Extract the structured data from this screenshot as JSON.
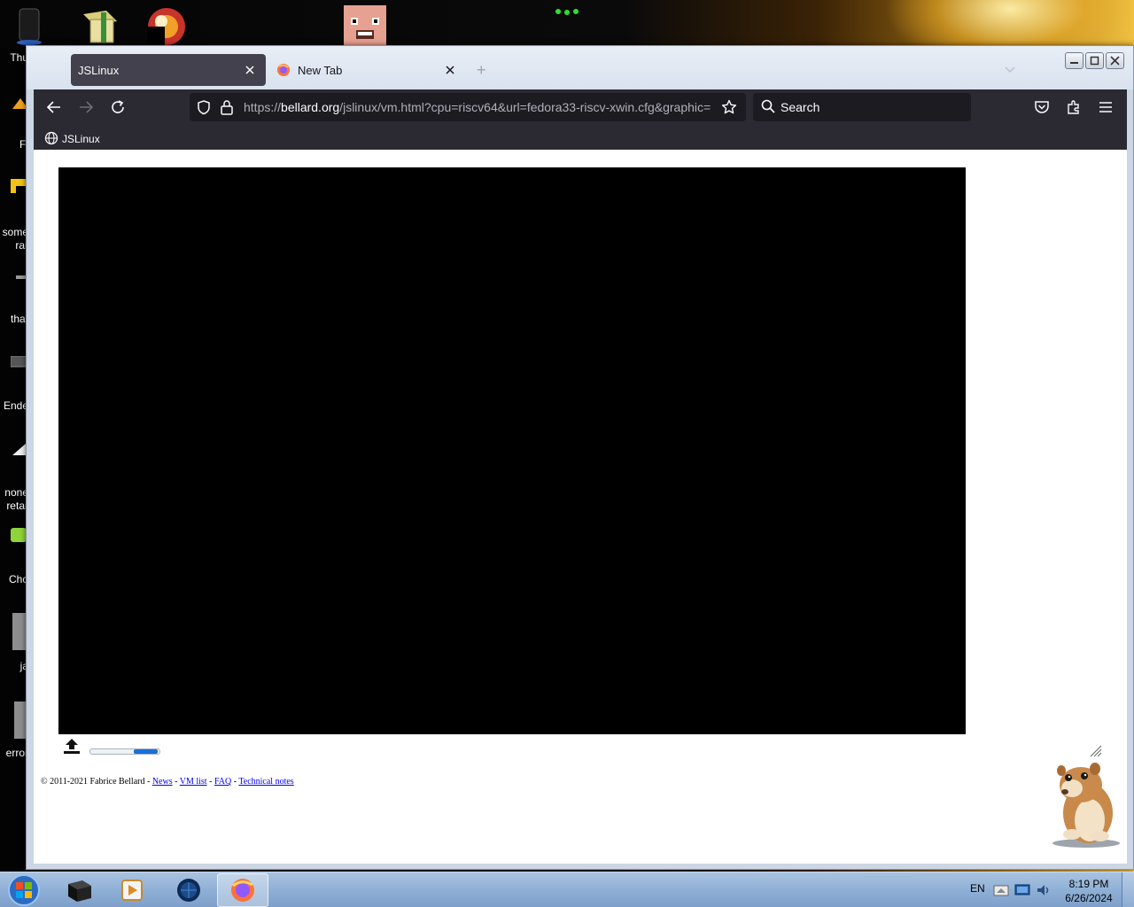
{
  "desktop": {
    "icon_labels": [
      "Thu",
      "Fi",
      "some",
      "rar",
      "that",
      "Ende",
      "none",
      "retar",
      "Cho",
      "ja",
      "error"
    ]
  },
  "browser": {
    "tabs": [
      {
        "title": "JSLinux",
        "active": true
      },
      {
        "title": "New Tab",
        "active": false
      }
    ],
    "url": {
      "scheme": "https://",
      "host": "bellard.org",
      "path": "/jslinux/vm.html?cpu=riscv64&url=fedora33-riscv-xwin.cfg&graphic="
    },
    "search_placeholder": "Search",
    "bookmarks": [
      {
        "label": "JSLinux"
      }
    ]
  },
  "page": {
    "progress": 0.35,
    "footer": {
      "copyright": "© 2011-2021 Fabrice Bellard - ",
      "links": [
        "News",
        "VM list",
        "FAQ",
        "Technical notes"
      ],
      "separator": " - "
    }
  },
  "taskbar": {
    "language": "EN",
    "time": "8:19 PM",
    "date": "6/26/2024"
  },
  "colors": {
    "toolbar": "#2b2a33",
    "urlbar": "#1c1b22",
    "active_tab": "#42414d",
    "taskbar": "#8fb0d6",
    "progress": "#1a6fd8"
  }
}
